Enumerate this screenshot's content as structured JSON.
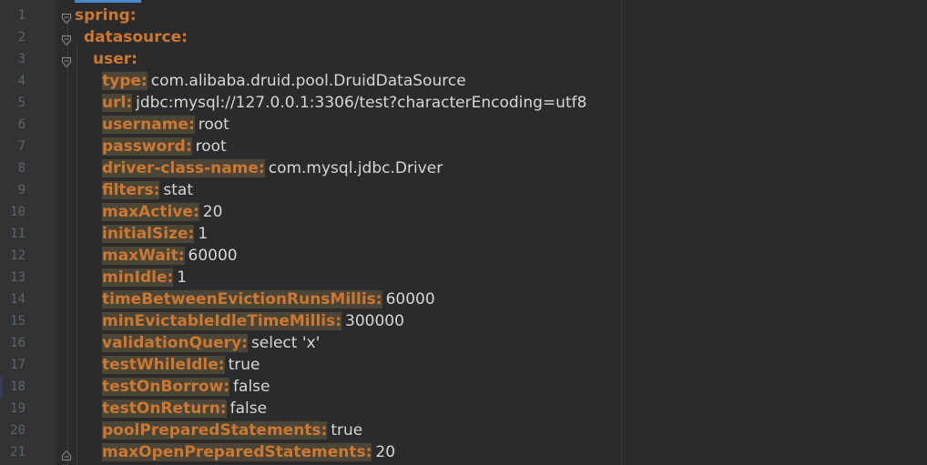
{
  "editor": {
    "lines": [
      {
        "num": "1",
        "key": "spring:",
        "value": "",
        "indent": 0,
        "fold": "open"
      },
      {
        "num": "2",
        "key": "datasource:",
        "value": "",
        "indent": 1,
        "fold": "open"
      },
      {
        "num": "3",
        "key": "user:",
        "value": "",
        "indent": 2,
        "fold": "open"
      },
      {
        "num": "4",
        "key": "type:",
        "value": "com.alibaba.druid.pool.DruidDataSource",
        "indent": 3,
        "fold": ""
      },
      {
        "num": "5",
        "key": "url:",
        "value": "jdbc:mysql://127.0.0.1:3306/test?characterEncoding=utf8",
        "indent": 3,
        "fold": ""
      },
      {
        "num": "6",
        "key": "username:",
        "value": "root",
        "indent": 3,
        "fold": ""
      },
      {
        "num": "7",
        "key": "password:",
        "value": "root",
        "indent": 3,
        "fold": ""
      },
      {
        "num": "8",
        "key": "driver-class-name:",
        "value": "com.mysql.jdbc.Driver",
        "indent": 3,
        "fold": ""
      },
      {
        "num": "9",
        "key": "filters:",
        "value": "stat",
        "indent": 3,
        "fold": ""
      },
      {
        "num": "10",
        "key": "maxActive:",
        "value": "20",
        "indent": 3,
        "fold": ""
      },
      {
        "num": "11",
        "key": "initialSize:",
        "value": "1",
        "indent": 3,
        "fold": ""
      },
      {
        "num": "12",
        "key": "maxWait:",
        "value": "60000",
        "indent": 3,
        "fold": ""
      },
      {
        "num": "13",
        "key": "minIdle:",
        "value": "1",
        "indent": 3,
        "fold": ""
      },
      {
        "num": "14",
        "key": "timeBetweenEvictionRunsMillis:",
        "value": "60000",
        "indent": 3,
        "fold": ""
      },
      {
        "num": "15",
        "key": "minEvictableIdleTimeMillis:",
        "value": "300000",
        "indent": 3,
        "fold": ""
      },
      {
        "num": "16",
        "key": "validationQuery:",
        "value": "select 'x'",
        "indent": 3,
        "fold": ""
      },
      {
        "num": "17",
        "key": "testWhileIdle:",
        "value": "true",
        "indent": 3,
        "fold": ""
      },
      {
        "num": "18",
        "key": "testOnBorrow:",
        "value": "false",
        "indent": 3,
        "fold": ""
      },
      {
        "num": "19",
        "key": "testOnReturn:",
        "value": "false",
        "indent": 3,
        "fold": ""
      },
      {
        "num": "20",
        "key": "poolPreparedStatements:",
        "value": "true",
        "indent": 3,
        "fold": ""
      },
      {
        "num": "21",
        "key": "maxOpenPreparedStatements:",
        "value": "20",
        "indent": 3,
        "fold": "end"
      }
    ]
  },
  "colors": {
    "background": "#2b2b2b",
    "gutter": "#313335",
    "key": "#cc7832",
    "key_highlight": "#4a4536",
    "value": "#d6d6d6",
    "line_number": "#606366"
  }
}
